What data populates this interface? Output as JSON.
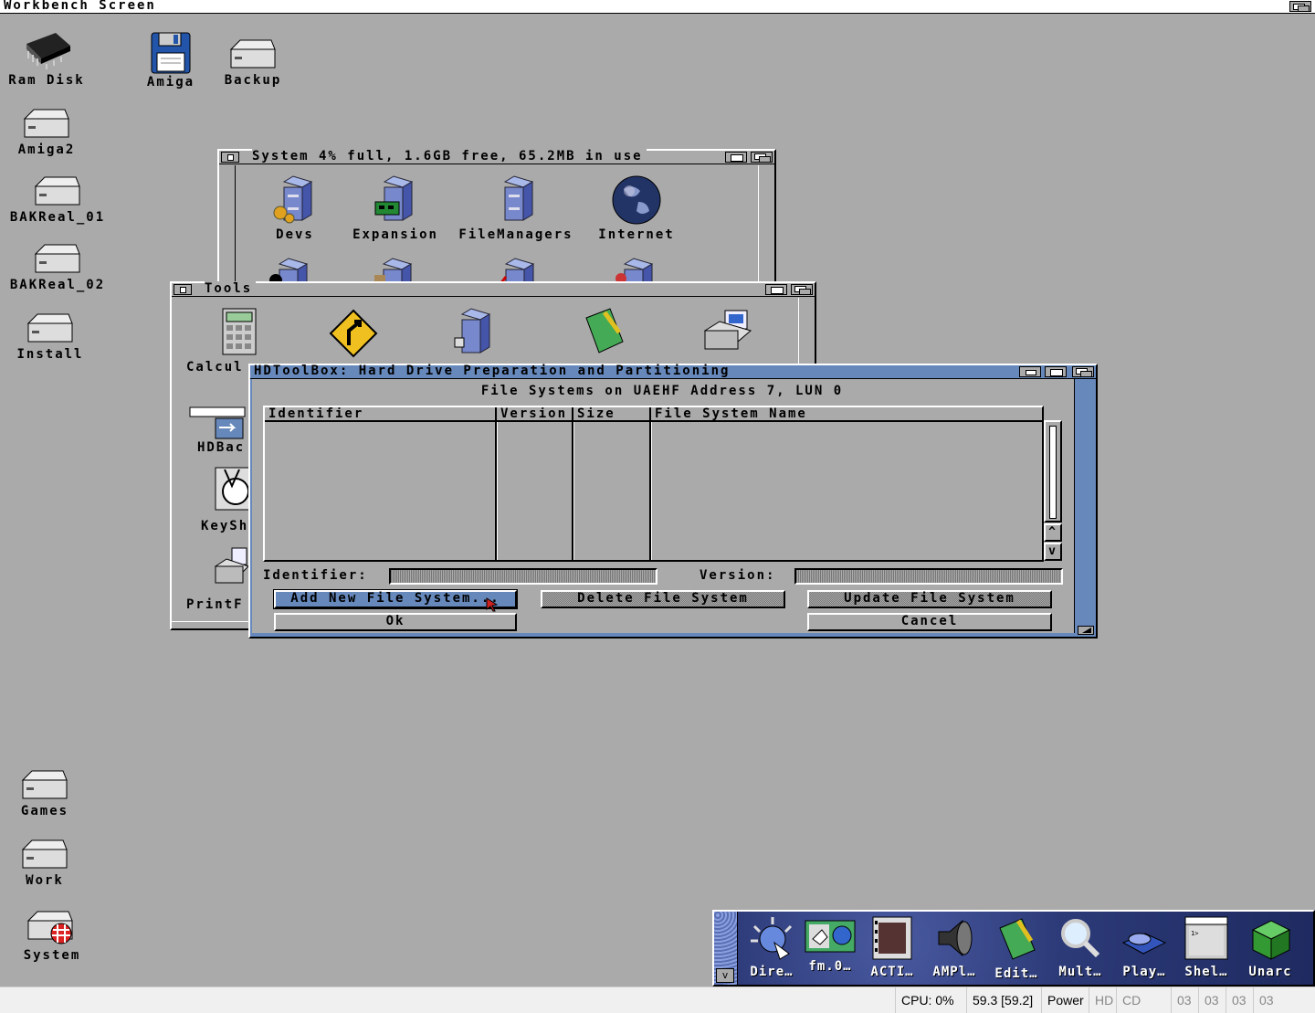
{
  "screen": {
    "title": "Workbench Screen"
  },
  "desktop_icons": {
    "ram_disk": "Ram Disk",
    "amiga": "Amiga",
    "backup": "Backup",
    "amiga2": "Amiga2",
    "bakreal01": "BAKReal_01",
    "bakreal02": "BAKReal_02",
    "install": "Install",
    "games": "Games",
    "work": "Work",
    "system": "System"
  },
  "system_window": {
    "title": "System  4% full, 1.6GB free, 65.2MB in use",
    "icons": [
      "Devs",
      "Expansion",
      "FileManagers",
      "Internet"
    ]
  },
  "tools_window": {
    "title": "Tools",
    "icons": [
      "Calcul",
      "HDBac",
      "KeySh",
      "PrintF"
    ]
  },
  "hdtoolbox": {
    "title": "HDToolBox: Hard Drive Preparation and Partitioning",
    "heading": "File Systems on UAEHF Address 7, LUN 0",
    "columns": [
      "Identifier",
      "Version",
      "Size",
      "File System Name"
    ],
    "identifier_label": "Identifier:",
    "version_label": "Version:",
    "identifier_value": "",
    "version_value": "",
    "add_button": "Add New File System...",
    "delete_button": "Delete File System",
    "update_button": "Update File System",
    "ok_button": "Ok",
    "cancel_button": "Cancel",
    "scroll_up": "^",
    "scroll_down": "v"
  },
  "dock": {
    "items": [
      "Dire…",
      "fm.0…",
      "ACTI…",
      "AMPl…",
      "Edit…",
      "Mult…",
      "Play…",
      "Shel…",
      "Unarc"
    ],
    "collapse_arrow": "v"
  },
  "statusbar": {
    "cpu": "CPU: 0%",
    "fps": "59.3 [59.2]",
    "power": "Power",
    "hd": "HD",
    "cd": "CD",
    "df": [
      "03",
      "03",
      "03",
      "03"
    ]
  },
  "colors": {
    "workbench_gray": "#aaaaaa",
    "active_blue": "#6688bb"
  }
}
